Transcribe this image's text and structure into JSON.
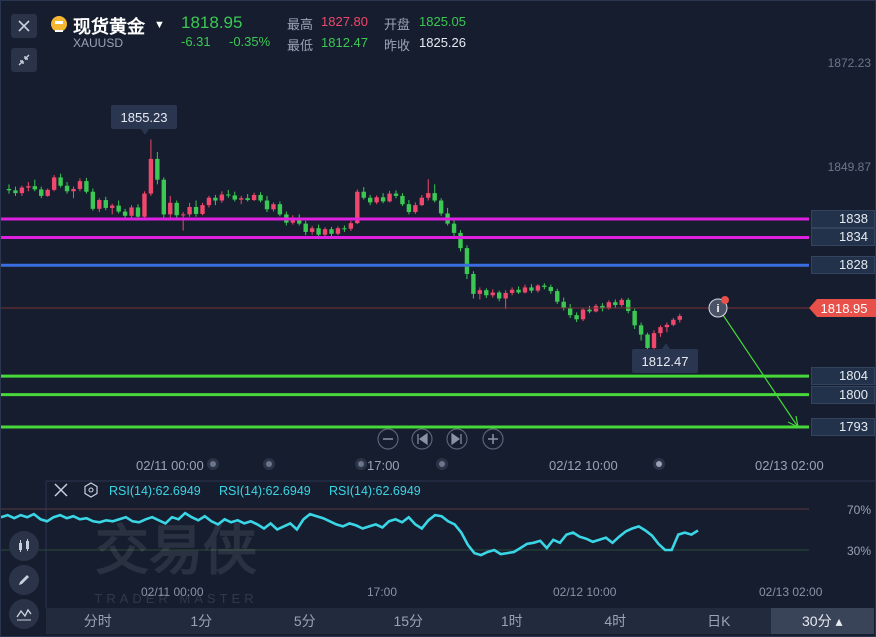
{
  "header": {
    "symbol_name": "现货黄金",
    "symbol_code": "XAUUSD",
    "last_price": "1818.95",
    "change": "-6.31",
    "change_pct": "-0.35%",
    "high_label": "最高",
    "high_value": "1827.80",
    "open_label": "开盘",
    "open_value": "1825.05",
    "low_label": "最低",
    "low_value": "1812.47",
    "prev_close_label": "昨收",
    "prev_close_value": "1825.26"
  },
  "price_axis": {
    "labels": [
      "1872.23",
      "1849.87"
    ]
  },
  "levels": [
    {
      "label": "1838",
      "value": 1838,
      "color": "#e020e0"
    },
    {
      "label": "1834",
      "value": 1834,
      "color": "#e020e0"
    },
    {
      "label": "1828",
      "value": 1828,
      "color": "#3a6ee0"
    },
    {
      "label": "1804",
      "value": 1804,
      "color": "#47d83a"
    },
    {
      "label": "1800",
      "value": 1800,
      "color": "#47d83a"
    },
    {
      "label": "1793",
      "value": 1793,
      "color": "#47d83a"
    }
  ],
  "current_price_tag": "1818.95",
  "annotations": {
    "high_callout": "1855.23",
    "low_callout": "1812.47"
  },
  "time_axis": [
    "02/11 00:00",
    "17:00",
    "02/12 10:00",
    "02/13 02:00"
  ],
  "rsi": {
    "labels": [
      "RSI(14):62.6949",
      "RSI(14):62.6949",
      "RSI(14):62.6949"
    ],
    "levels": [
      "70%",
      "30%"
    ],
    "time_axis": [
      "02/11 00:00",
      "17:00",
      "02/12 10:00",
      "02/13 02:00"
    ]
  },
  "watermark": {
    "main": "交易侠",
    "sub": "TRADER MASTER"
  },
  "timeframes": [
    {
      "label": "分时",
      "active": false
    },
    {
      "label": "1分",
      "active": false
    },
    {
      "label": "5分",
      "active": false
    },
    {
      "label": "15分",
      "active": false
    },
    {
      "label": "1时",
      "active": false
    },
    {
      "label": "4时",
      "active": false
    },
    {
      "label": "日K",
      "active": false
    },
    {
      "label": "30分 ▴",
      "active": true
    }
  ],
  "colors": {
    "up": "#f0476c",
    "down": "#3bc953",
    "rsi_line": "#3ad6e6",
    "current_price": "#e8504a",
    "background": "#151d2e"
  },
  "chart_data": {
    "type": "candlestick",
    "timeframe": "30分",
    "ylim": [
      1790,
      1874
    ],
    "levels": [
      1838,
      1834,
      1828,
      1804,
      1800,
      1793
    ],
    "high": 1855.23,
    "low": 1812.47,
    "last": 1818.95,
    "candles": [
      [
        1844.5,
        1845.5,
        1843.5,
        1844.2
      ],
      [
        1844.2,
        1845.0,
        1843.0,
        1843.6
      ],
      [
        1843.6,
        1845.2,
        1843.0,
        1844.8
      ],
      [
        1844.8,
        1846.0,
        1844.0,
        1845.1
      ],
      [
        1845.1,
        1846.5,
        1844.0,
        1844.4
      ],
      [
        1844.4,
        1845.0,
        1842.5,
        1843.0
      ],
      [
        1843.0,
        1844.6,
        1842.8,
        1844.3
      ],
      [
        1844.3,
        1847.5,
        1844.0,
        1847.0
      ],
      [
        1847.0,
        1847.8,
        1844.8,
        1845.2
      ],
      [
        1845.2,
        1846.0,
        1843.5,
        1844.0
      ],
      [
        1844.0,
        1845.0,
        1842.5,
        1844.5
      ],
      [
        1844.5,
        1846.8,
        1844.0,
        1846.2
      ],
      [
        1846.2,
        1846.9,
        1843.5,
        1843.9
      ],
      [
        1843.9,
        1844.6,
        1839.8,
        1840.2
      ],
      [
        1840.2,
        1842.5,
        1839.5,
        1842.1
      ],
      [
        1842.1,
        1842.8,
        1839.9,
        1840.4
      ],
      [
        1840.4,
        1841.3,
        1839.0,
        1840.9
      ],
      [
        1840.9,
        1842.0,
        1839.2,
        1839.6
      ],
      [
        1839.6,
        1840.2,
        1838.2,
        1838.7
      ],
      [
        1838.7,
        1841.0,
        1838.0,
        1840.5
      ],
      [
        1840.5,
        1841.2,
        1838.0,
        1838.5
      ],
      [
        1838.5,
        1844.0,
        1838.0,
        1843.5
      ],
      [
        1843.5,
        1855.2,
        1843.0,
        1851.0
      ],
      [
        1851.0,
        1852.5,
        1845.5,
        1846.5
      ],
      [
        1846.5,
        1847.0,
        1838.0,
        1839.0
      ],
      [
        1839.0,
        1843.0,
        1838.0,
        1841.5
      ],
      [
        1841.5,
        1842.0,
        1838.2,
        1838.8
      ],
      [
        1838.8,
        1839.5,
        1835.5,
        1839.0
      ],
      [
        1839.0,
        1841.5,
        1838.5,
        1840.6
      ],
      [
        1840.6,
        1842.0,
        1838.5,
        1839.1
      ],
      [
        1839.1,
        1841.5,
        1838.8,
        1841.0
      ],
      [
        1841.0,
        1843.0,
        1840.5,
        1842.6
      ],
      [
        1842.6,
        1843.2,
        1841.0,
        1842.0
      ],
      [
        1842.0,
        1844.0,
        1841.5,
        1843.3
      ],
      [
        1843.3,
        1844.3,
        1842.6,
        1843.1
      ],
      [
        1843.1,
        1843.9,
        1841.8,
        1842.2
      ],
      [
        1842.2,
        1843.0,
        1841.2,
        1842.5
      ],
      [
        1842.5,
        1843.4,
        1841.8,
        1842.1
      ],
      [
        1842.1,
        1843.7,
        1841.9,
        1843.2
      ],
      [
        1843.2,
        1843.8,
        1841.6,
        1842.0
      ],
      [
        1842.0,
        1843.0,
        1839.5,
        1840.1
      ],
      [
        1840.1,
        1841.6,
        1839.6,
        1841.2
      ],
      [
        1841.2,
        1841.8,
        1838.6,
        1839.0
      ],
      [
        1839.0,
        1839.6,
        1836.6,
        1837.2
      ],
      [
        1837.2,
        1838.8,
        1836.8,
        1838.3
      ],
      [
        1838.3,
        1839.0,
        1836.6,
        1837.0
      ],
      [
        1837.0,
        1837.6,
        1834.5,
        1835.2
      ],
      [
        1835.2,
        1836.5,
        1834.6,
        1836.0
      ],
      [
        1836.0,
        1836.8,
        1834.0,
        1834.6
      ],
      [
        1834.6,
        1836.2,
        1834.2,
        1835.8
      ],
      [
        1835.8,
        1836.3,
        1834.3,
        1834.8
      ],
      [
        1834.8,
        1836.4,
        1834.5,
        1836.0
      ],
      [
        1836.0,
        1836.6,
        1835.2,
        1835.9
      ],
      [
        1835.9,
        1837.6,
        1835.4,
        1837.1
      ],
      [
        1837.1,
        1844.4,
        1836.9,
        1843.9
      ],
      [
        1843.9,
        1844.9,
        1842.2,
        1842.6
      ],
      [
        1842.6,
        1843.2,
        1841.0,
        1841.6
      ],
      [
        1841.6,
        1843.1,
        1841.2,
        1842.7
      ],
      [
        1842.7,
        1843.6,
        1841.4,
        1841.8
      ],
      [
        1841.8,
        1844.1,
        1841.6,
        1843.5
      ],
      [
        1843.5,
        1844.2,
        1842.5,
        1843.0
      ],
      [
        1843.0,
        1843.6,
        1840.8,
        1841.2
      ],
      [
        1841.2,
        1842.1,
        1839.0,
        1839.5
      ],
      [
        1839.5,
        1841.6,
        1839.1,
        1841.0
      ],
      [
        1841.0,
        1843.2,
        1840.8,
        1842.6
      ],
      [
        1842.6,
        1846.6,
        1842.0,
        1843.6
      ],
      [
        1843.6,
        1845.5,
        1841.6,
        1842.0
      ],
      [
        1842.0,
        1842.5,
        1838.7,
        1839.2
      ],
      [
        1839.2,
        1840.4,
        1836.6,
        1837.0
      ],
      [
        1837.0,
        1837.8,
        1834.2,
        1835.0
      ],
      [
        1835.0,
        1835.6,
        1831.0,
        1831.7
      ],
      [
        1831.7,
        1832.3,
        1825.0,
        1826.1
      ],
      [
        1826.1,
        1826.7,
        1820.8,
        1821.8
      ],
      [
        1821.8,
        1823.2,
        1820.6,
        1822.6
      ],
      [
        1822.6,
        1823.0,
        1820.9,
        1821.5
      ],
      [
        1821.5,
        1822.8,
        1821.0,
        1822.1
      ],
      [
        1822.1,
        1822.5,
        1820.2,
        1820.8
      ],
      [
        1820.8,
        1822.6,
        1818.5,
        1822.0
      ],
      [
        1822.0,
        1823.2,
        1821.5,
        1822.7
      ],
      [
        1822.7,
        1823.4,
        1821.8,
        1822.1
      ],
      [
        1822.1,
        1823.8,
        1821.9,
        1823.2
      ],
      [
        1823.2,
        1823.9,
        1822.0,
        1822.5
      ],
      [
        1822.5,
        1823.9,
        1822.1,
        1823.6
      ],
      [
        1823.6,
        1824.1,
        1822.8,
        1823.3
      ],
      [
        1823.3,
        1823.8,
        1821.8,
        1822.4
      ],
      [
        1822.4,
        1822.9,
        1819.6,
        1820.1
      ],
      [
        1820.1,
        1821.0,
        1818.2,
        1818.8
      ],
      [
        1818.8,
        1819.6,
        1816.6,
        1817.2
      ],
      [
        1817.2,
        1817.8,
        1815.7,
        1816.3
      ],
      [
        1816.3,
        1818.8,
        1815.9,
        1818.4
      ],
      [
        1818.4,
        1819.2,
        1817.6,
        1818.0
      ],
      [
        1818.0,
        1819.6,
        1817.8,
        1819.2
      ],
      [
        1819.2,
        1819.8,
        1818.0,
        1818.6
      ],
      [
        1818.6,
        1820.4,
        1818.4,
        1820.0
      ],
      [
        1820.0,
        1820.6,
        1818.8,
        1819.4
      ],
      [
        1819.4,
        1820.9,
        1819.0,
        1820.5
      ],
      [
        1820.5,
        1820.9,
        1817.6,
        1818.1
      ],
      [
        1818.1,
        1818.6,
        1814.2,
        1815.0
      ],
      [
        1815.0,
        1815.6,
        1811.7,
        1813.0
      ],
      [
        1813.0,
        1813.4,
        1809.5,
        1810.1
      ],
      [
        1810.1,
        1813.9,
        1809.8,
        1813.3
      ],
      [
        1813.3,
        1815.0,
        1812.5,
        1814.6
      ],
      [
        1814.6,
        1815.6,
        1813.5,
        1815.1
      ],
      [
        1815.1,
        1816.6,
        1814.8,
        1816.2
      ],
      [
        1816.2,
        1817.5,
        1815.6,
        1817.0
      ]
    ],
    "rsi_series": [
      62,
      64,
      61,
      64,
      62,
      65,
      60,
      58,
      62,
      64,
      61,
      63,
      60,
      61,
      58,
      57,
      59,
      58,
      60,
      62,
      58,
      57,
      60,
      62,
      59,
      56,
      62,
      60,
      66,
      62,
      59,
      63,
      58,
      55,
      60,
      57,
      59,
      56,
      58,
      55,
      51,
      56,
      50,
      53,
      56,
      50,
      60,
      65,
      63,
      61,
      58,
      55,
      53,
      56,
      54,
      51,
      53,
      55,
      52,
      58,
      60,
      57,
      62,
      55,
      51,
      59,
      64,
      63,
      58,
      55,
      47,
      35,
      27,
      25,
      28,
      30,
      26,
      27,
      28,
      32,
      36,
      37,
      39,
      32,
      40,
      37,
      45,
      47,
      43,
      41,
      38,
      40,
      42,
      37,
      43,
      48,
      51,
      53,
      49,
      44,
      36,
      30,
      30,
      45,
      47,
      45,
      49
    ]
  }
}
